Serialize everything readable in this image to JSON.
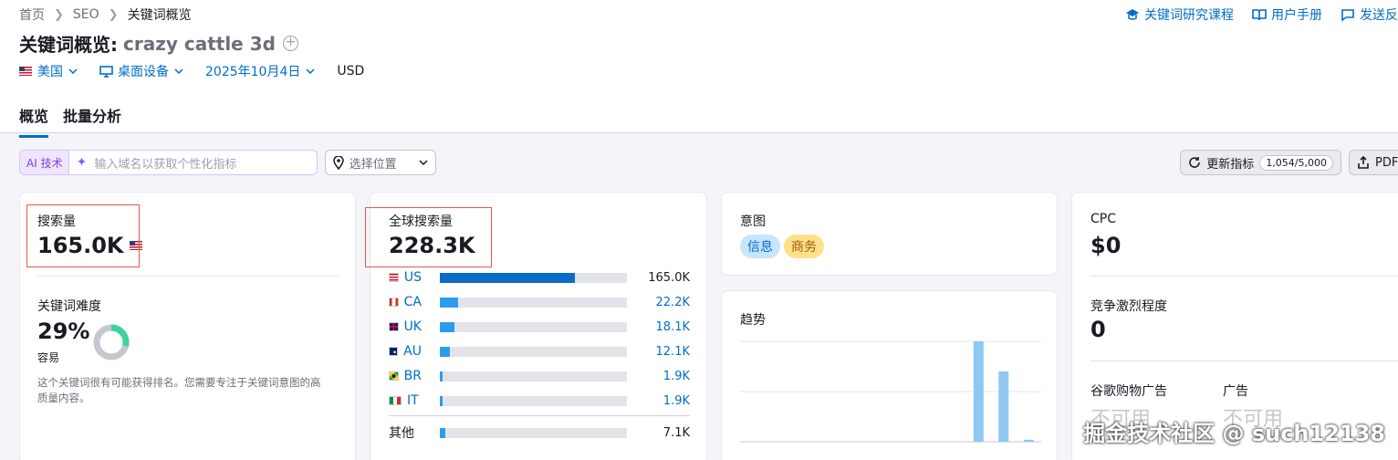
{
  "breadcrumb": [
    "首页",
    "SEO",
    "关键词概览"
  ],
  "top_links": [
    {
      "label": "关键词研究课程",
      "icon": "graduation-cap-icon"
    },
    {
      "label": "用户手册",
      "icon": "book-icon"
    },
    {
      "label": "发送反",
      "icon": "feedback-icon"
    }
  ],
  "title": {
    "prefix": "关键词概览:",
    "keyword": "crazy cattle 3d"
  },
  "filters": {
    "country": "美国",
    "device": "桌面设备",
    "date": "2025年10月4日",
    "currency": "USD"
  },
  "tabs": [
    "概览",
    "批量分析"
  ],
  "toolbar": {
    "ai_label": "AI 技术",
    "domain_placeholder": "输入域名以获取个性化指标",
    "location_placeholder": "选择位置",
    "update_label": "更新指标",
    "update_count": "1,054/5,000",
    "pdf_label": "PDF"
  },
  "volume": {
    "label": "搜索量",
    "value": "165.0K"
  },
  "difficulty": {
    "label": "关键词难度",
    "value": "29%",
    "level": "容易",
    "percent": 29,
    "desc_line1": "这个关键词很有可能获得排名。您需要专注于关键词意图的高",
    "desc_line2": "质量内容。"
  },
  "global_volume": {
    "label": "全球搜索量",
    "value": "228.3K",
    "countries": [
      {
        "code": "US",
        "value": "165.0K",
        "share": 0.72
      },
      {
        "code": "CA",
        "value": "22.2K",
        "share": 0.097
      },
      {
        "code": "UK",
        "value": "18.1K",
        "share": 0.079
      },
      {
        "code": "AU",
        "value": "12.1K",
        "share": 0.053
      },
      {
        "code": "BR",
        "value": "1.9K",
        "share": 0.012
      },
      {
        "code": "IT",
        "value": "1.9K",
        "share": 0.012
      }
    ],
    "other": {
      "label": "其他",
      "value": "7.1K",
      "share": 0.031
    }
  },
  "intent": {
    "label": "意图",
    "badges": [
      "信息",
      "商务"
    ]
  },
  "trend": {
    "label": "趋势",
    "values": [
      0,
      0,
      0,
      0,
      0,
      0,
      0,
      0,
      0,
      1.0,
      0.7,
      0.02
    ]
  },
  "cpc": {
    "label": "CPC",
    "value": "$0"
  },
  "competition": {
    "label": "竞争激烈程度",
    "value": "0"
  },
  "shopping_ads": {
    "label": "谷歌购物广告",
    "value": "不可用"
  },
  "ads": {
    "label": "广告",
    "value": "不可用"
  },
  "watermark": "掘金技术社区 @ such12138",
  "colors": {
    "accent": "#006dca",
    "bar_us": "#0a6cc8",
    "bar_other": "#2d9cf0",
    "donut_fill": "#3fd39a"
  }
}
